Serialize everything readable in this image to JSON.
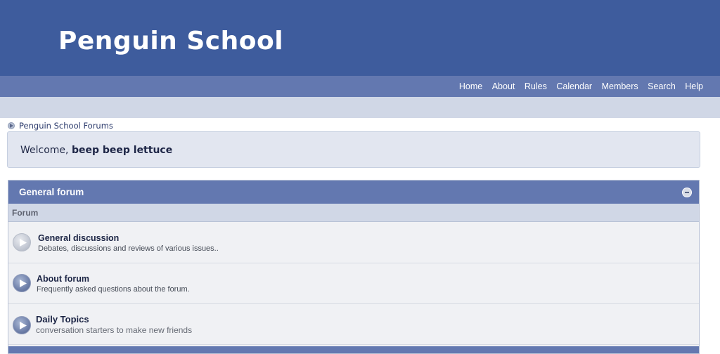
{
  "site": {
    "title": "Penguin School"
  },
  "nav": {
    "items": [
      "Home",
      "About",
      "Rules",
      "Calendar",
      "Members",
      "Search",
      "Help"
    ]
  },
  "breadcrumb": {
    "label": "Penguin School Forums"
  },
  "welcome": {
    "prefix": "Welcome, ",
    "username": "beep beep lettuce"
  },
  "category": {
    "title": "General forum",
    "column_header": "Forum",
    "forums": [
      {
        "title": "General discussion",
        "description": "Debates, discussions and reviews of various issues..",
        "read": true
      },
      {
        "title": "About forum",
        "description": "Frequently asked questions about the forum.",
        "read": false
      },
      {
        "title": "Daily Topics",
        "description": "conversation starters to make new friends",
        "read": false
      }
    ]
  }
}
